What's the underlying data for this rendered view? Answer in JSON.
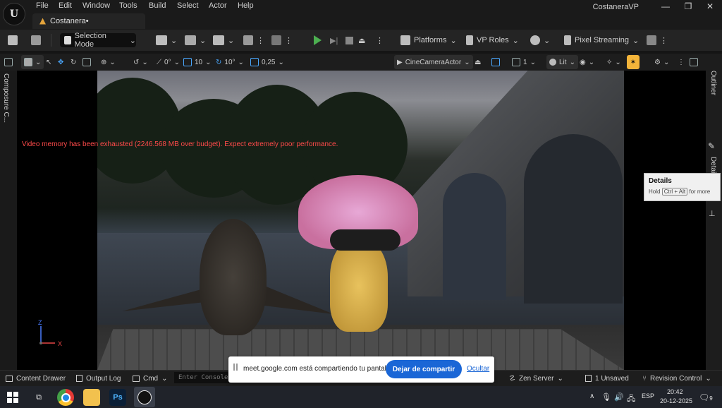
{
  "menu": {
    "file": "File",
    "edit": "Edit",
    "window": "Window",
    "tools": "Tools",
    "build": "Build",
    "select": "Select",
    "actor": "Actor",
    "help": "Help"
  },
  "project": {
    "tab": "Costanera•",
    "name": "CostaneraVP"
  },
  "window_controls": {
    "minimize": "—",
    "restore": "❐",
    "close": "✕"
  },
  "toolbar": {
    "selection_mode": "Selection Mode",
    "platforms": "Platforms",
    "vp_roles": "VP Roles",
    "pixel_streaming": "Pixel Streaming"
  },
  "viewport_toolbar": {
    "rotate_snap": "0°",
    "grid_snap": "10",
    "angle_snap": "10°",
    "scale_snap": "0,25",
    "camera": "CineCameraActor",
    "view_count": "1",
    "lit": "Lit"
  },
  "left_panel": {
    "composure": "Composure C..."
  },
  "right_panel": {
    "outliner": "Outliner",
    "details": "Details"
  },
  "viewport": {
    "memory_warning": "Video memory has been exhausted (2246.568 MB over budget). Expect extremely poor performance.",
    "axis_z": "Z",
    "axis_x": "X"
  },
  "tooltip": {
    "title": "Details",
    "hold": "Hold",
    "keys": "Ctrl + Alt",
    "rest": "for more"
  },
  "statusbar": {
    "content_drawer": "Content Drawer",
    "output_log": "Output Log",
    "cmd": "Cmd",
    "console_placeholder": "Enter Console",
    "zen_server": "Zen Server",
    "unsaved": "1 Unsaved",
    "revision_control": "Revision Control"
  },
  "share": {
    "text": "meet.google.com está compartiendo tu pantalla.",
    "stop": "Dejar de compartir",
    "hide": "Ocultar"
  },
  "taskbar": {
    "lang": "ESP",
    "time": "20:42",
    "date": "20-12-2025",
    "notifications": "9"
  }
}
